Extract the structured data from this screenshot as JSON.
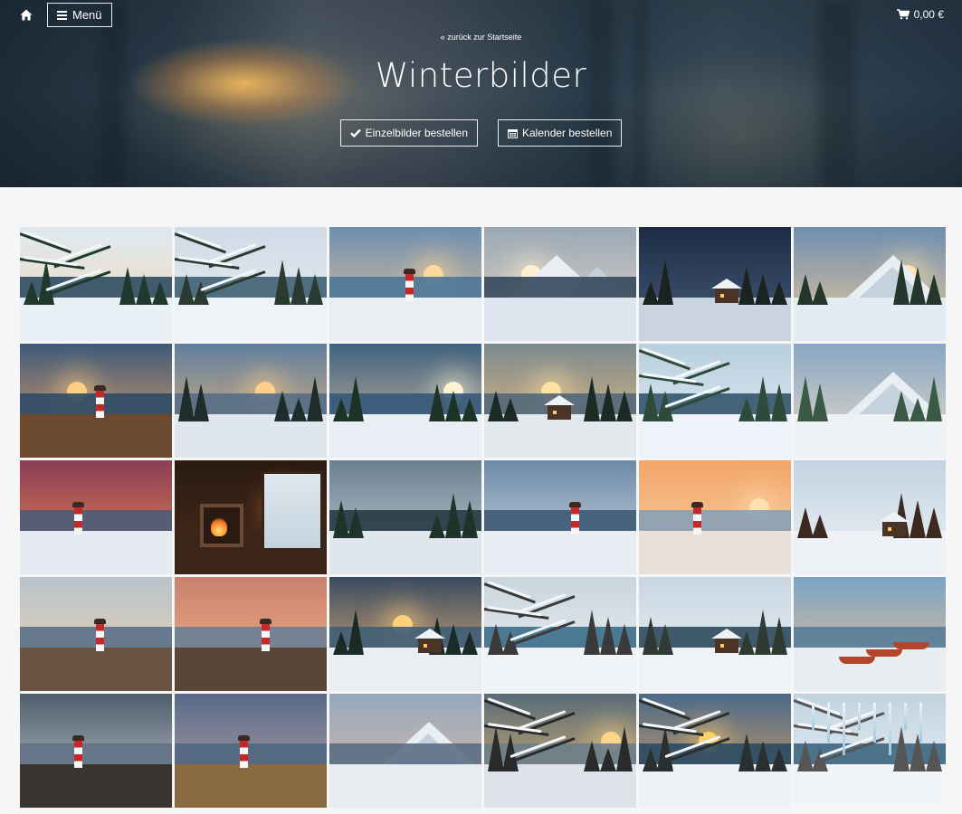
{
  "header": {
    "menu_label": "Menü",
    "cart_total": "0,00 €",
    "back_link": "« zurück zur Startseite",
    "title": "Winterbilder",
    "order_single_label": "Einzelbilder bestellen",
    "order_calendar_label": "Kalender bestellen"
  },
  "icons": {
    "home": "home-icon",
    "menu": "hamburger-icon",
    "cart": "cart-icon",
    "check": "check-icon",
    "calendar": "calendar-icon"
  },
  "gallery": [
    {
      "scene": "winter-stream-forest"
    },
    {
      "scene": "snowy-branches-lake-cabin"
    },
    {
      "scene": "lighthouse-snow-sunset"
    },
    {
      "scene": "frozen-waterfall-mountains"
    },
    {
      "scene": "village-night-road"
    },
    {
      "scene": "alpine-cabin-sunrise"
    },
    {
      "scene": "lighthouse-rocky-coast"
    },
    {
      "scene": "sunset-lake-forest"
    },
    {
      "scene": "river-valley-sunset"
    },
    {
      "scene": "cabin-lake-evening"
    },
    {
      "scene": "frozen-lake-snowy-trees"
    },
    {
      "scene": "snow-forest-mountains"
    },
    {
      "scene": "lighthouse-red-sky"
    },
    {
      "scene": "cozy-fireplace-room"
    },
    {
      "scene": "forest-lake-cabin"
    },
    {
      "scene": "lighthouse-snowy-cliffs"
    },
    {
      "scene": "lighthouse-boats-bay"
    },
    {
      "scene": "snowy-pavilion-forest"
    },
    {
      "scene": "lighthouse-cliff-dusk"
    },
    {
      "scene": "lighthouse-path-coast"
    },
    {
      "scene": "cabin-icy-stream-night"
    },
    {
      "scene": "icy-river-white-forest"
    },
    {
      "scene": "frozen-lake-red-cabin"
    },
    {
      "scene": "boats-frozen-shore"
    },
    {
      "scene": "lighthouse-rocks-stormy-sky"
    },
    {
      "scene": "lighthouse-dunes-twilight"
    },
    {
      "scene": "fjord-village-dusk"
    },
    {
      "scene": "icy-trees-sunset-river"
    },
    {
      "scene": "frozen-river-sunset"
    },
    {
      "scene": "icicles-frozen-stream"
    }
  ]
}
